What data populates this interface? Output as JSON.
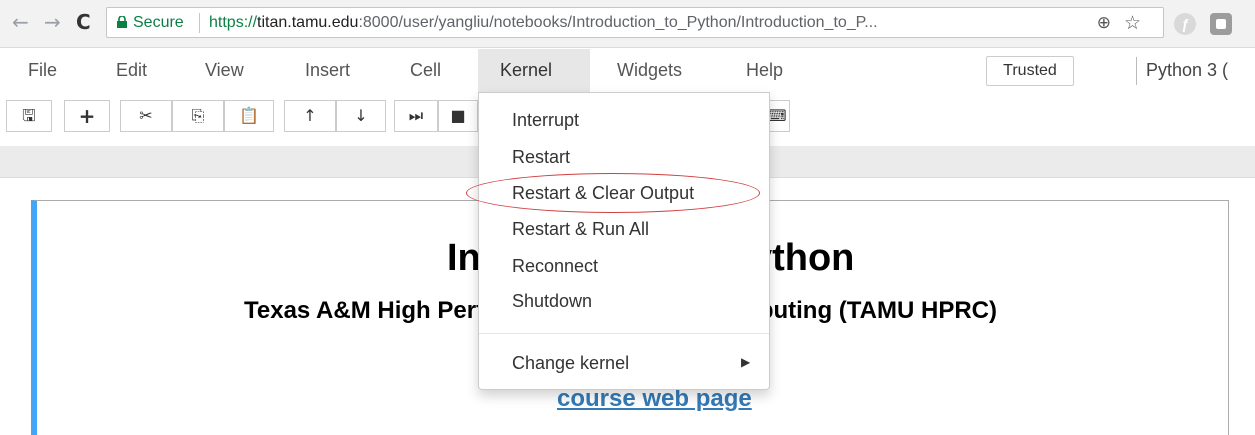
{
  "browser": {
    "secure_label": "Secure",
    "url_proto": "https://",
    "url_host": "titan.tamu.edu",
    "url_rest": ":8000/user/yangliu/notebooks/Introduction_to_Python/Introduction_to_P...",
    "back_icon": "←",
    "forward_icon": "→",
    "reload_icon": "C",
    "zoom_icon": "⊕",
    "star_icon": "☆",
    "ext1_icon": "ƒ"
  },
  "menubar": {
    "items": [
      "File",
      "Edit",
      "View",
      "Insert",
      "Cell",
      "Kernel",
      "Widgets",
      "Help"
    ],
    "trusted": "Trusted",
    "kernel_name": "Python 3 ("
  },
  "toolbar": {
    "save": "🖫",
    "add": "+",
    "cut": "✂",
    "copy": "⎘",
    "paste": "📋",
    "up": "↑",
    "down": "↓",
    "run": "⏭",
    "stop": "■",
    "palette": "⌨"
  },
  "kernel_menu": {
    "items": [
      "Interrupt",
      "Restart",
      "Restart & Clear Output",
      "Restart & Run All",
      "Reconnect",
      "Shutdown"
    ],
    "change_kernel": "Change kernel",
    "submenu_arrow": "▶",
    "highlighted_item": "Restart & Clear Output",
    "highlight_color": "#d04040"
  },
  "cell": {
    "title": "Introduction to Python",
    "subtitle": "Texas A&M High Performance Research Computing (TAMU HPRC)",
    "link": "course web page",
    "border_color": "#42a5f5"
  }
}
